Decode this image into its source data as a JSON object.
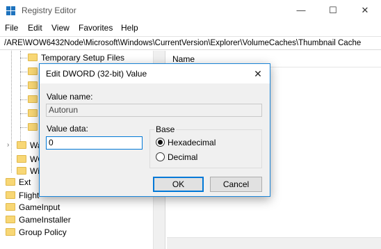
{
  "window": {
    "title": "Registry Editor",
    "controls": {
      "minimize": "—",
      "maximize": "☐",
      "close": "✕"
    }
  },
  "menu": [
    "File",
    "Edit",
    "View",
    "Favorites",
    "Help"
  ],
  "address": "/ARE\\WOW6432Node\\Microsoft\\Windows\\CurrentVersion\\Explorer\\VolumeCaches\\Thumbnail Cache",
  "tree": {
    "items": [
      "Temporary Setup Files",
      "Wa",
      "WO",
      "Wi",
      "Ext",
      "Flight",
      "GameInput",
      "GameInstaller",
      "Group Policy"
    ]
  },
  "list": {
    "name_header": "Name"
  },
  "dialog": {
    "title": "Edit DWORD (32-bit) Value",
    "close_glyph": "✕",
    "value_name_label": "Value name:",
    "value_name": "Autorun",
    "value_data_label": "Value data:",
    "value_data": "0",
    "base_label": "Base",
    "options": [
      {
        "label": "Hexadecimal",
        "checked": true
      },
      {
        "label": "Decimal",
        "checked": false
      }
    ],
    "ok_label": "OK",
    "cancel_label": "Cancel"
  },
  "icons": {
    "app": "registry-icon",
    "folder": "folder-icon",
    "expand": "chevron-right-icon"
  },
  "colors": {
    "accent": "#0078d7",
    "folder": "#f8d775",
    "dialog_bg": "#f0f0f0"
  }
}
